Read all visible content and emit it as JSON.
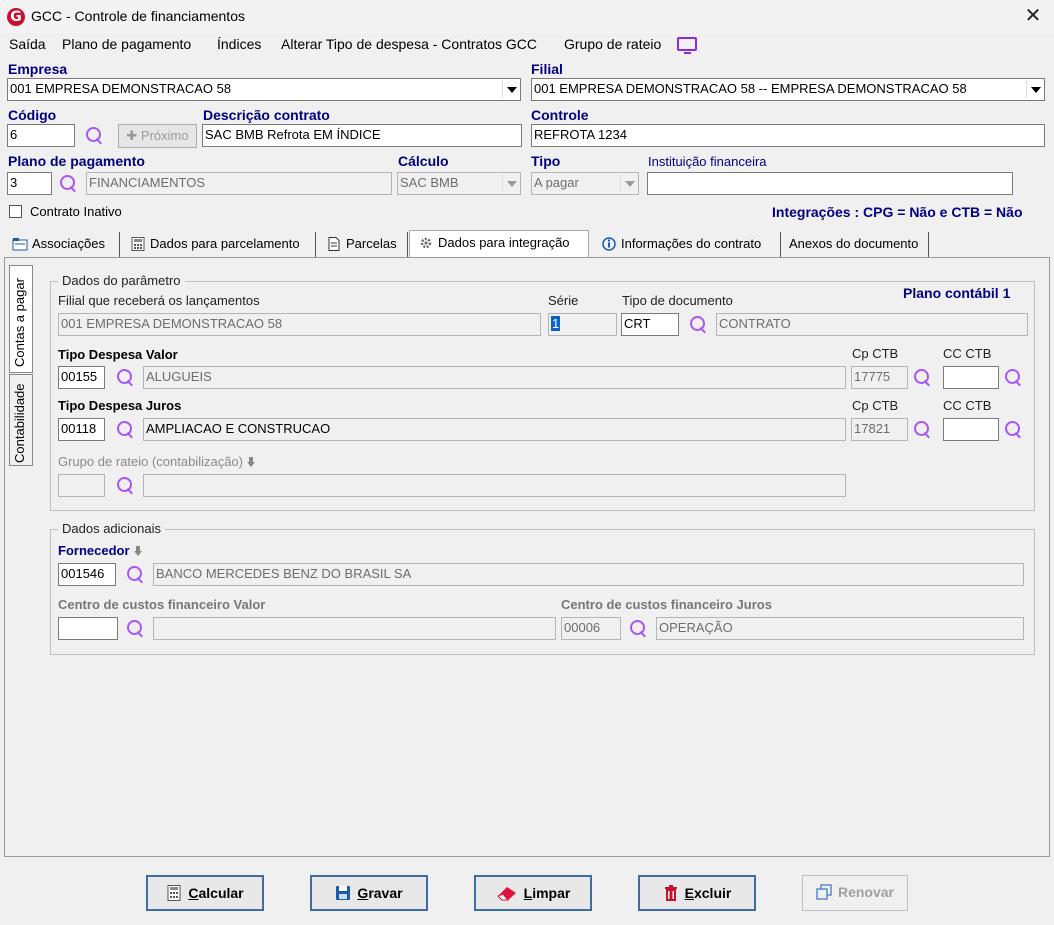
{
  "window": {
    "title": "GCC - Controle de financiamentos",
    "logo_letter": "G"
  },
  "menu": [
    "Saída",
    "Plano de pagamento",
    "Índices",
    "Alterar Tipo de despesa - Contratos GCC",
    "Grupo de rateio"
  ],
  "empresa": {
    "label": "Empresa",
    "value": "001 EMPRESA DEMONSTRACAO 58"
  },
  "filial": {
    "label": "Filial",
    "value": "001 EMPRESA DEMONSTRACAO 58 -- EMPRESA DEMONSTRACAO 58"
  },
  "codigo": {
    "label": "Código",
    "value": "6",
    "proximo_label": "Próximo"
  },
  "descricao": {
    "label": "Descrição contrato",
    "value": "SAC BMB Refrota EM ÍNDICE"
  },
  "controle": {
    "label": "Controle",
    "value": "REFROTA 1234"
  },
  "plano": {
    "label": "Plano de pagamento",
    "code": "3",
    "name": "FINANCIAMENTOS"
  },
  "calculo": {
    "label": "Cálculo",
    "value": "SAC BMB"
  },
  "tipo": {
    "label": "Tipo",
    "value": "A pagar"
  },
  "instituicao": {
    "label": "Instituição financeira",
    "value": ""
  },
  "contrato_inativo": {
    "label": "Contrato Inativo",
    "checked": false
  },
  "integracoes": "Integrações : CPG = Não e CTB = Não",
  "tabs": [
    "Associações",
    "Dados para parcelamento",
    "Parcelas",
    "Dados para integração",
    "Informações do contrato",
    "Anexos do documento"
  ],
  "vertical_tabs": [
    "Contas a pagar",
    "Contabilidade"
  ],
  "parametro": {
    "group_title": "Dados do parâmetro",
    "filial_label": "Filial que receberá os lançamentos",
    "filial_value": "001 EMPRESA DEMONSTRACAO 58",
    "serie_label": "Série",
    "serie_value": "1",
    "tipo_doc_label": "Tipo de documento",
    "tipo_doc_code": "CRT",
    "tipo_doc_name": "CONTRATO",
    "plano_contabil": "Plano contábil 1",
    "despesa_valor": {
      "label": "Tipo Despesa Valor",
      "code": "00155",
      "name": "ALUGUEIS",
      "cp_ctb_label": "Cp CTB",
      "cp_ctb": "17775",
      "cc_ctb_label": "CC CTB",
      "cc_ctb": ""
    },
    "despesa_juros": {
      "label": "Tipo Despesa Juros",
      "code": "00118",
      "name": "AMPLIACAO E CONSTRUCAO",
      "cp_ctb_label": "Cp CTB",
      "cp_ctb": "17821",
      "cc_ctb_label": "CC CTB",
      "cc_ctb": ""
    },
    "grupo_rateio": {
      "label": "Grupo de rateio (contabilização)",
      "code": "",
      "name": ""
    }
  },
  "adicionais": {
    "group_title": "Dados adicionais",
    "fornecedor": {
      "label": "Fornecedor",
      "code": "001546",
      "name": "BANCO MERCEDES BENZ DO BRASIL SA"
    },
    "cc_valor": {
      "label": "Centro de custos financeiro Valor",
      "code": "",
      "name": ""
    },
    "cc_juros": {
      "label": "Centro de custos financeiro Juros",
      "code": "00006",
      "name": "OPERAÇÃO"
    }
  },
  "buttons": {
    "calcular": {
      "first": "C",
      "rest": "alcular"
    },
    "gravar": {
      "first": "G",
      "rest": "ravar"
    },
    "limpar": {
      "first": "L",
      "rest": "impar"
    },
    "excluir": {
      "first": "E",
      "rest": "xcluir"
    },
    "renovar": "Renovar"
  }
}
